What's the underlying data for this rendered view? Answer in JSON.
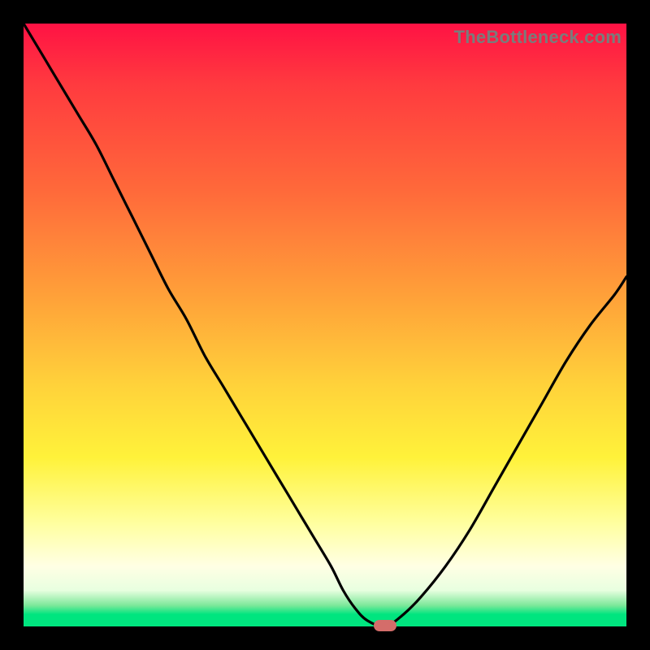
{
  "watermark": "TheBottleneck.com",
  "colors": {
    "frame": "#000000",
    "curve": "#000000",
    "pill": "#d46d6a",
    "gradient_top": "#ff1244",
    "gradient_bottom": "#00e57f",
    "watermark": "#7b7b7b"
  },
  "chart_data": {
    "type": "line",
    "title": "",
    "xlabel": "",
    "ylabel": "",
    "xlim": [
      0,
      100
    ],
    "ylim": [
      0,
      100
    ],
    "x": [
      0,
      3,
      6,
      9,
      12,
      15,
      18,
      21,
      24,
      27,
      30,
      33,
      36,
      39,
      42,
      45,
      48,
      51,
      53,
      55,
      57,
      60,
      63,
      66,
      70,
      74,
      78,
      82,
      86,
      90,
      94,
      98,
      100
    ],
    "values": [
      100,
      95,
      90,
      85,
      80,
      74,
      68,
      62,
      56,
      51,
      45,
      40,
      35,
      30,
      25,
      20,
      15,
      10,
      6,
      3,
      1,
      0,
      2,
      5,
      10,
      16,
      23,
      30,
      37,
      44,
      50,
      55,
      58
    ],
    "minimum_marker": {
      "x": 60,
      "y": 0
    },
    "legend": [],
    "annotations": []
  }
}
